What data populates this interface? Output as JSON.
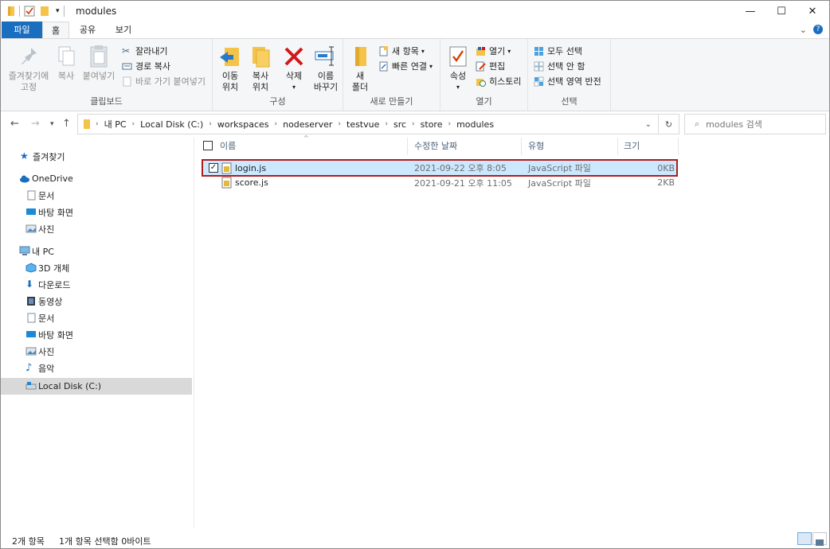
{
  "window": {
    "title": "modules",
    "controls": [
      "—",
      "☐",
      "✕"
    ]
  },
  "tabs": {
    "file": "파일",
    "home": "홈",
    "share": "공유",
    "view": "보기"
  },
  "ribbon": {
    "clipboard": {
      "label": "클립보드",
      "pin": "즐겨찾기에\n고정",
      "copy": "복사",
      "paste": "붙여넣기",
      "cut": "잘라내기",
      "copy_path": "경로 복사",
      "paste_shortcut": "바로 가기 붙여넣기"
    },
    "organize": {
      "label": "구성",
      "move_to": "이동\n위치",
      "copy_to": "복사\n위치",
      "delete": "삭제",
      "rename": "이름\n바꾸기"
    },
    "new": {
      "label": "새로 만들기",
      "new_folder": "새\n폴더",
      "new_item": "새 항목",
      "easy_access": "빠른 연결"
    },
    "open": {
      "label": "열기",
      "properties": "속성",
      "open": "열기",
      "edit": "편집",
      "history": "히스토리"
    },
    "select": {
      "label": "선택",
      "select_all": "모두 선택",
      "select_none": "선택 안 함",
      "invert": "선택 영역 반전"
    }
  },
  "address": {
    "crumbs": [
      "내 PC",
      "Local Disk (C:)",
      "workspaces",
      "nodeserver",
      "testvue",
      "src",
      "store",
      "modules"
    ],
    "search_placeholder": "modules 검색"
  },
  "navpane": {
    "quick_access": "즐겨찾기",
    "onedrive": "OneDrive",
    "onedrive_items": [
      "문서",
      "바탕 화면",
      "사진"
    ],
    "this_pc": "내 PC",
    "pc_items": [
      "3D 개체",
      "다운로드",
      "동영상",
      "문서",
      "바탕 화면",
      "사진",
      "음악",
      "Local Disk (C:)"
    ]
  },
  "filelist": {
    "columns": {
      "name": "이름",
      "modified": "수정한 날짜",
      "type": "유형",
      "size": "크기"
    },
    "rows": [
      {
        "name": "login.js",
        "modified": "2021-09-22 오후 8:05",
        "type": "JavaScript 파일",
        "size": "0KB",
        "selected": true
      },
      {
        "name": "score.js",
        "modified": "2021-09-21 오후 11:05",
        "type": "JavaScript 파일",
        "size": "2KB",
        "selected": false
      }
    ]
  },
  "status": {
    "count": "2개 항목",
    "selection": "1개 항목 선택함 0바이트"
  },
  "colors": {
    "file_tab": "#1a6ec0",
    "selection_bg": "#cce8ff",
    "highlight_border": "#b01c1c",
    "folder": "#f4c34a"
  }
}
